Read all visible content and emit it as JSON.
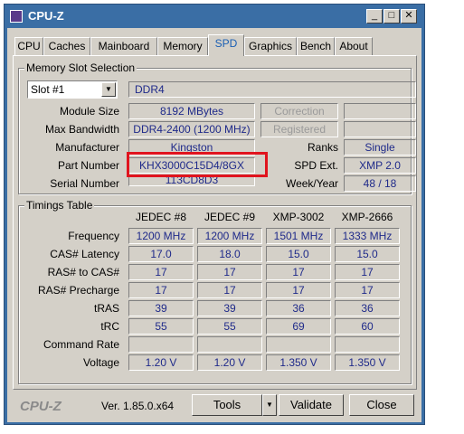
{
  "window": {
    "title": "CPU-Z"
  },
  "title_buttons": {
    "minimize": "_",
    "maximize": "□",
    "close": "✕"
  },
  "tabs": [
    "CPU",
    "Caches",
    "Mainboard",
    "Memory",
    "SPD",
    "Graphics",
    "Bench",
    "About"
  ],
  "memory_slot": {
    "group_label": "Memory Slot Selection",
    "slot_value": "Slot #1",
    "type": "DDR4",
    "module_size_label": "Module Size",
    "module_size": "8192 MBytes",
    "max_bandwidth_label": "Max Bandwidth",
    "max_bandwidth": "DDR4-2400 (1200 MHz)",
    "manufacturer_label": "Manufacturer",
    "manufacturer": "Kingston",
    "part_number_label": "Part Number",
    "part_number": "KHX3000C15D4/8GX",
    "serial_number_label": "Serial Number",
    "serial_number": "113CD8D3",
    "correction_label": "Correction",
    "registered_label": "Registered",
    "ranks_label": "Ranks",
    "ranks": "Single",
    "spd_ext_label": "SPD Ext.",
    "spd_ext": "XMP 2.0",
    "week_year_label": "Week/Year",
    "week_year": "48 / 18"
  },
  "timings": {
    "group_label": "Timings Table",
    "columns": [
      "JEDEC #8",
      "JEDEC #9",
      "XMP-3002",
      "XMP-2666"
    ],
    "rows": [
      {
        "label": "Frequency",
        "values": [
          "1200 MHz",
          "1200 MHz",
          "1501 MHz",
          "1333 MHz"
        ]
      },
      {
        "label": "CAS# Latency",
        "values": [
          "17.0",
          "18.0",
          "15.0",
          "15.0"
        ]
      },
      {
        "label": "RAS# to CAS#",
        "values": [
          "17",
          "17",
          "17",
          "17"
        ]
      },
      {
        "label": "RAS# Precharge",
        "values": [
          "17",
          "17",
          "17",
          "17"
        ]
      },
      {
        "label": "tRAS",
        "values": [
          "39",
          "39",
          "36",
          "36"
        ]
      },
      {
        "label": "tRC",
        "values": [
          "55",
          "55",
          "69",
          "60"
        ]
      },
      {
        "label": "Command Rate",
        "values": [
          "",
          "",
          "",
          ""
        ]
      },
      {
        "label": "Voltage",
        "values": [
          "1.20 V",
          "1.20 V",
          "1.350 V",
          "1.350 V"
        ]
      }
    ]
  },
  "footer": {
    "brand": "CPU-Z",
    "version": "Ver. 1.85.0.x64",
    "tools": "Tools",
    "validate": "Validate",
    "close": "Close"
  },
  "colors": {
    "title_bar": "#3a6ea5",
    "face": "#d4d0c8",
    "value_text": "#1f2a8a",
    "highlight_box": "#e0141e"
  }
}
